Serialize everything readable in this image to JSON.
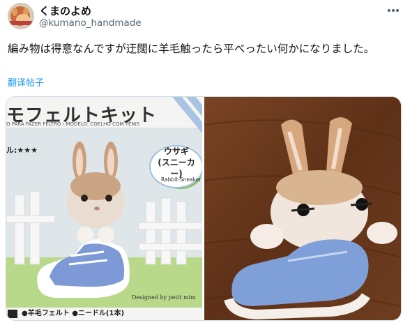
{
  "tweet": {
    "display_name": "くまのよめ",
    "handle": "@kumano_handmade",
    "text": "編み物は得意なんですが迂闊に羊毛触ったら平べったい何かになりました。",
    "translate_label": "翻译帖子",
    "more_icon": "more-horizontal-icon",
    "avatar_icon": "bear-avatar"
  },
  "media": {
    "left_photo": {
      "package_title": "モフェルトキット",
      "package_subtitle": "O PARA FAZER FELTRO・MODELO: COELHO COM TÊNIS",
      "difficulty": "ル:★★★",
      "product_name_jp": "ウサギ\n(スニーカー)",
      "product_name_en": "Rabbit-Sneaker",
      "designer": "Designed by petit mim",
      "contents": "●羊毛フェルト ●ニードル(1本)"
    },
    "right_photo": {
      "subject": "felted-rabbit-result"
    }
  },
  "colors": {
    "accent": "#1d9bf0",
    "secondary_text": "#536471",
    "sneaker_blue": "#7f9fd8"
  }
}
